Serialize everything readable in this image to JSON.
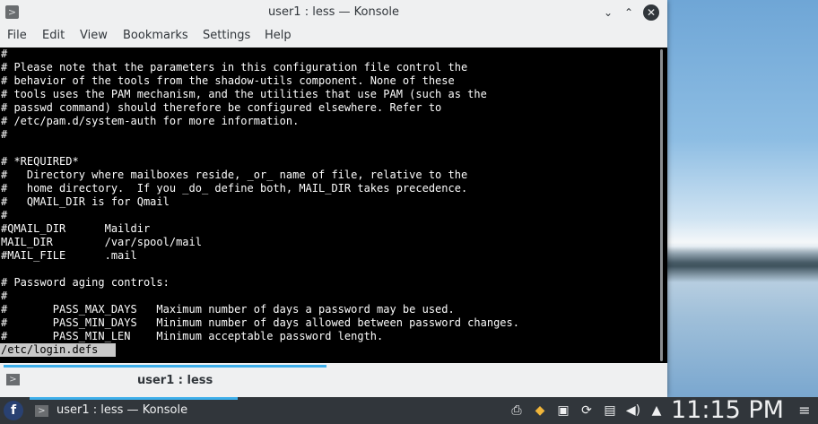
{
  "window": {
    "title": "user1 : less — Konsole",
    "minimize_glyph": "⌄",
    "maximize_glyph": "⌃",
    "close_glyph": "✕",
    "app_icon": "terminal-icon"
  },
  "menubar": {
    "items": [
      {
        "label": "File"
      },
      {
        "label": "Edit"
      },
      {
        "label": "View"
      },
      {
        "label": "Bookmarks"
      },
      {
        "label": "Settings"
      },
      {
        "label": "Help"
      }
    ]
  },
  "terminal": {
    "lines": "#\n# Please note that the parameters in this configuration file control the\n# behavior of the tools from the shadow-utils component. None of these\n# tools uses the PAM mechanism, and the utilities that use PAM (such as the\n# passwd command) should therefore be configured elsewhere. Refer to\n# /etc/pam.d/system-auth for more information.\n#\n\n# *REQUIRED*\n#   Directory where mailboxes reside, _or_ name of file, relative to the\n#   home directory.  If you _do_ define both, MAIL_DIR takes precedence.\n#   QMAIL_DIR is for Qmail\n#\n#QMAIL_DIR      Maildir\nMAIL_DIR        /var/spool/mail\n#MAIL_FILE      .mail\n\n# Password aging controls:\n#\n#       PASS_MAX_DAYS   Maximum number of days a password may be used.\n#       PASS_MIN_DAYS   Minimum number of days allowed between password changes.\n#       PASS_MIN_LEN    Minimum acceptable password length.",
    "status": "/etc/login.defs "
  },
  "tabs": [
    {
      "label": "user1 : less"
    }
  ],
  "taskbar": {
    "task_label": "user1 : less — Konsole",
    "clock": "11:15 PM",
    "tray_icons": [
      "printer-icon",
      "package-updates-icon",
      "display-icon",
      "update-icon",
      "clipboard-icon",
      "volume-icon",
      "expand-arrow-icon"
    ]
  },
  "colors": {
    "accent": "#3daee9",
    "panel": "#31363b",
    "window_bg": "#eff0f1"
  }
}
